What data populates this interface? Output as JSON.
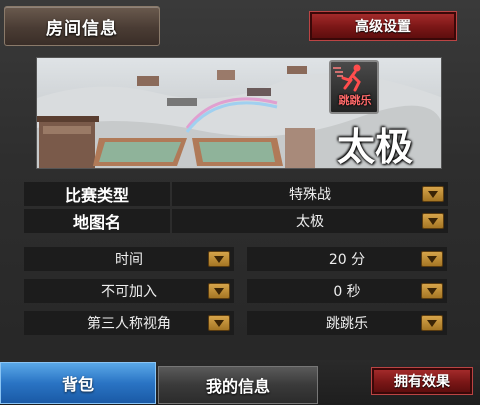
{
  "header": {
    "room_info_tab": "房间信息",
    "advanced_settings": "高级设置"
  },
  "map_preview": {
    "badge_label": "跳跳乐",
    "map_name": "太极"
  },
  "settings": {
    "match_type_label": "比赛类型",
    "match_type_value": "特殊战",
    "map_label": "地图名",
    "map_value": "太极"
  },
  "options": {
    "time": "时间",
    "time_value": "20 分",
    "join": "不可加入",
    "join_value": "0 秒",
    "view": "第三人称视角",
    "mode_value": "跳跳乐"
  },
  "footer": {
    "backpack_tab": "背包",
    "my_info_tab": "我的信息",
    "effects_button": "拥有效果"
  },
  "colors": {
    "accent_red": "#7a1616",
    "dropdown_gold": "#d6a44a",
    "active_tab_blue": "#2a74c4"
  }
}
